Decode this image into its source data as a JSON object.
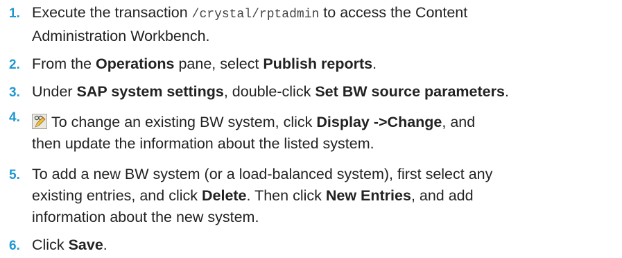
{
  "steps": [
    {
      "number": "1.",
      "before": "Execute the transaction ",
      "code": "/crystal/rptadmin",
      "after_line1": " to access the Content",
      "line2": "Administration Workbench."
    },
    {
      "number": "2.",
      "before": "From the ",
      "bold1": "Operations",
      "mid": " pane, select ",
      "bold2": "Publish reports",
      "after": "."
    },
    {
      "number": "3.",
      "before": "Under ",
      "bold1": "SAP system settings",
      "mid": ", double-click ",
      "bold2": "Set BW source parameters",
      "after": "."
    },
    {
      "number": "4.",
      "icon": "edit-pencil-glasses-icon",
      "before": "To change an existing BW system, click ",
      "bold1": "Display ->Change",
      "mid": ", and",
      "line2": "then update the information about the listed system."
    },
    {
      "number": "5.",
      "line1": "To add a new BW system (or a load-balanced system), first select any",
      "line2_before": "existing entries, and click ",
      "line2_bold1": "Delete",
      "line2_mid": ". Then click ",
      "line2_bold2": "New Entries",
      "line2_after": ", and add",
      "line3": "information about the new system."
    },
    {
      "number": "6.",
      "before": "Click ",
      "bold1": "Save",
      "after": "."
    }
  ],
  "colors": {
    "number": "#1f97d1",
    "text": "#222222"
  }
}
